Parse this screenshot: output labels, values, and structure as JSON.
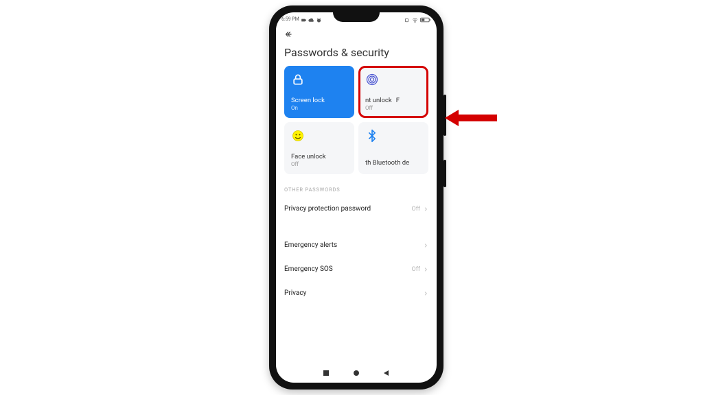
{
  "status": {
    "time": "6:59 PM"
  },
  "header": {
    "title": "Passwords & security"
  },
  "tiles": {
    "screen_lock": {
      "label": "Screen lock",
      "status": "On"
    },
    "fingerprint": {
      "label": "nt unlock",
      "extra": "F",
      "status": "Off"
    },
    "face_unlock": {
      "label": "Face unlock",
      "status": "Off"
    },
    "bluetooth": {
      "label": "th Bluetooth de",
      "status": ""
    }
  },
  "sections": {
    "other_passwords": "OTHER PASSWORDS"
  },
  "rows": {
    "privacy_protection": {
      "label": "Privacy protection password",
      "value": "Off"
    },
    "emergency_alerts": {
      "label": "Emergency alerts",
      "value": ""
    },
    "emergency_sos": {
      "label": "Emergency SOS",
      "value": "Off"
    },
    "privacy": {
      "label": "Privacy",
      "value": ""
    }
  }
}
